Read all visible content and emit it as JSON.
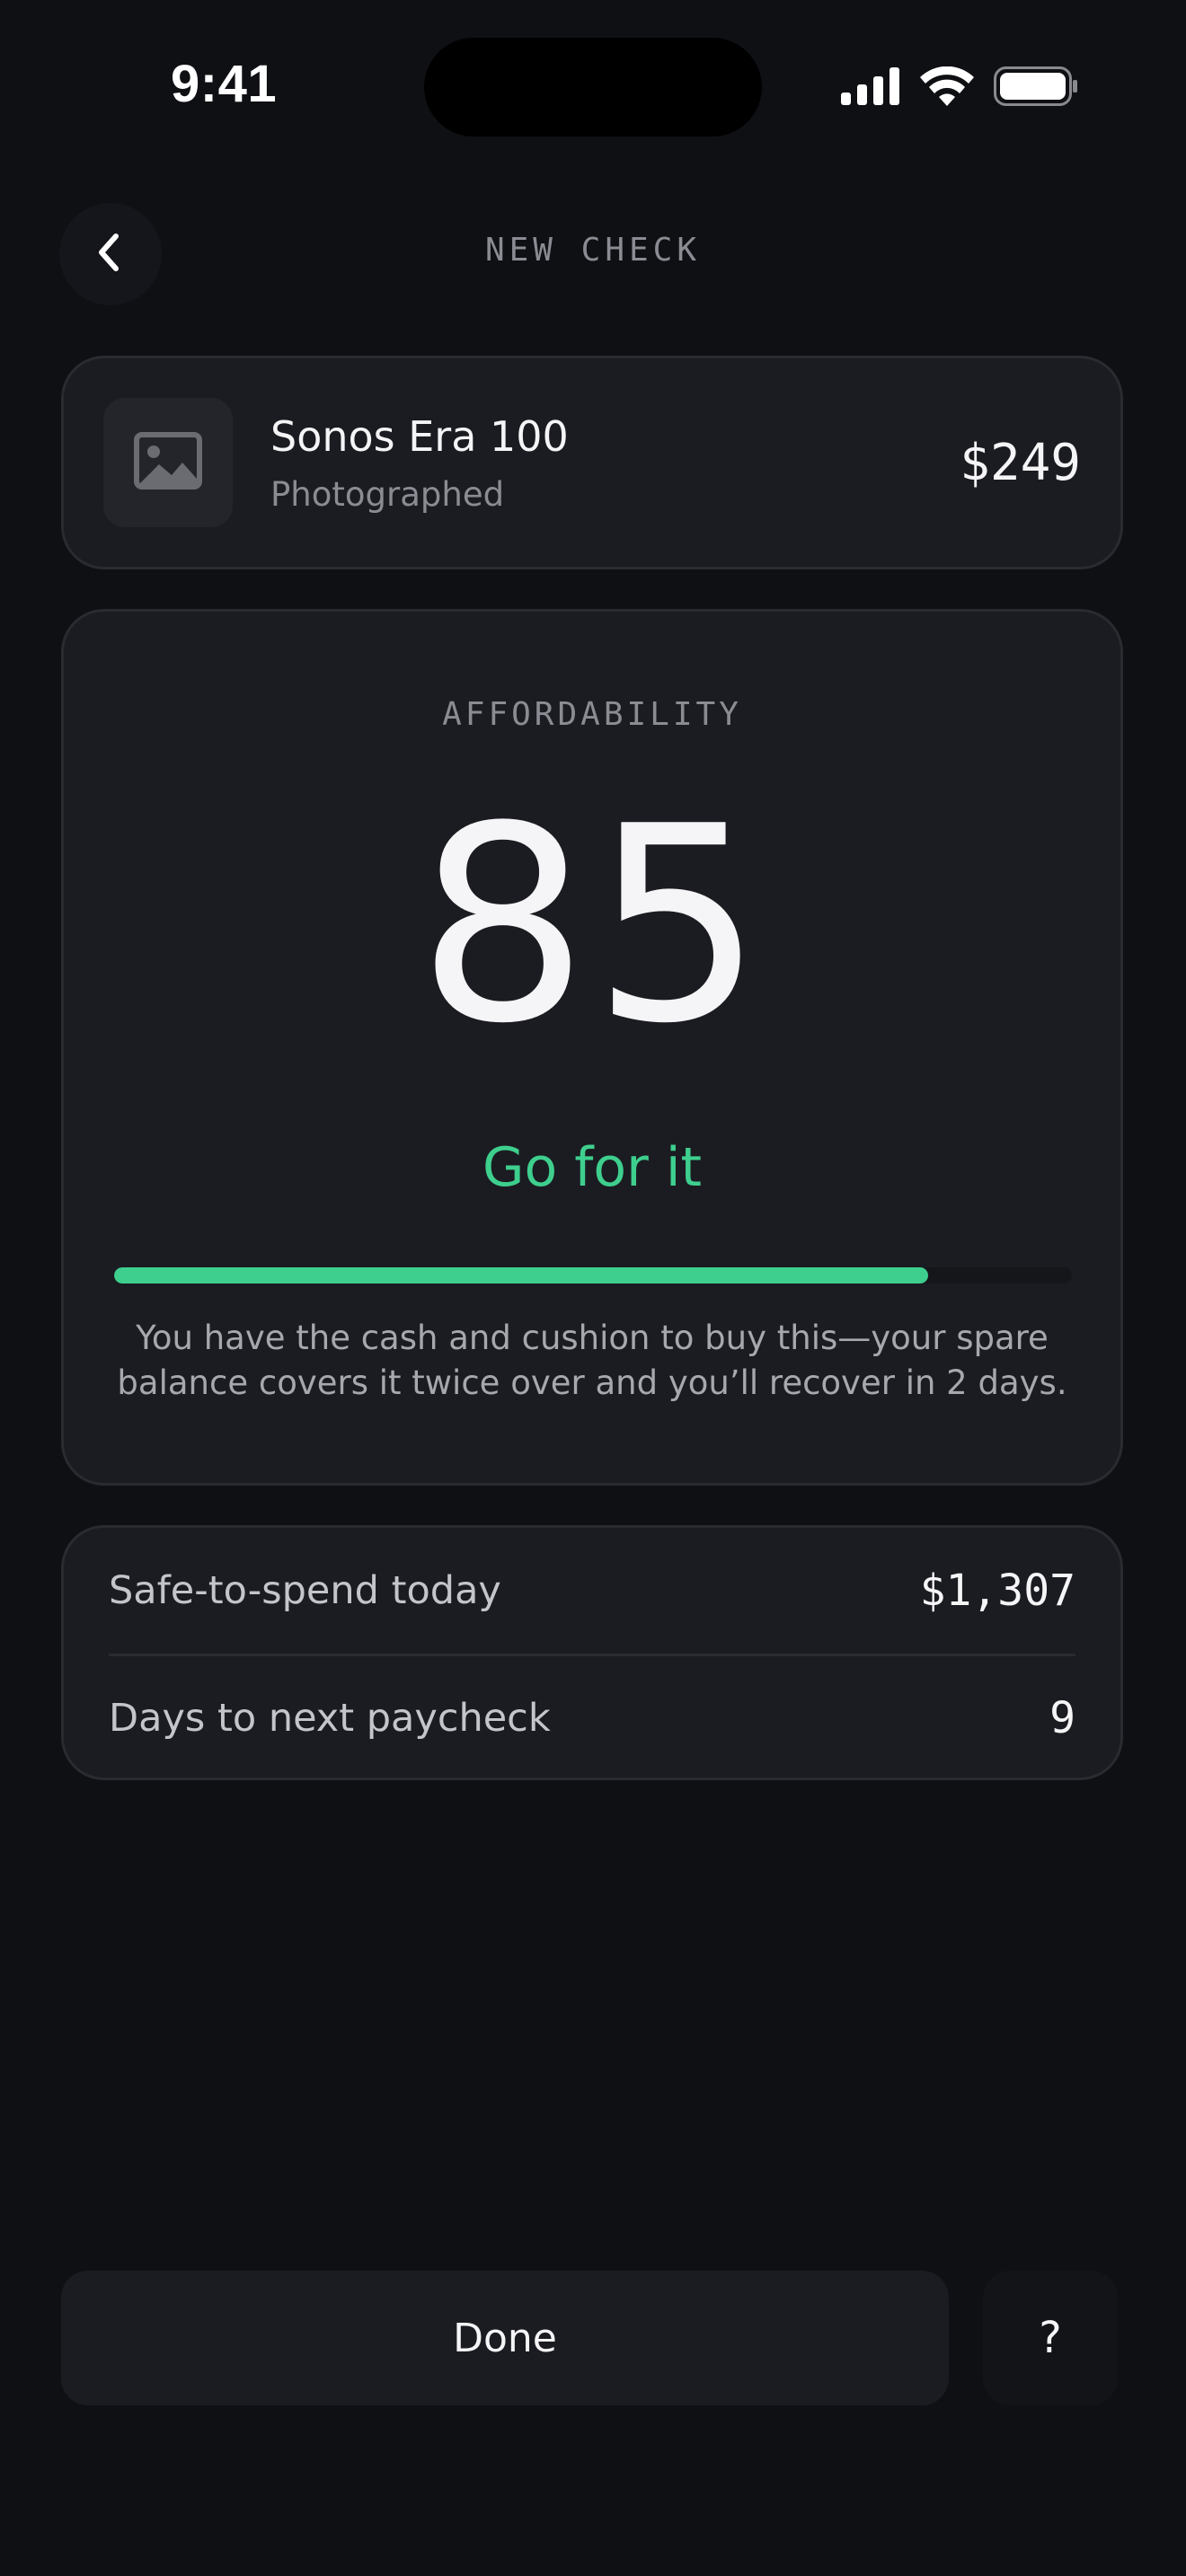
{
  "status_bar": {
    "time": "9:41",
    "signal_icon": "cellular-signal-icon",
    "wifi_icon": "wifi-icon",
    "battery_icon": "battery-icon"
  },
  "header": {
    "back_icon": "chevron-left-icon",
    "title": "NEW CHECK"
  },
  "product": {
    "thumbnail_icon": "image-placeholder-icon",
    "name": "Sonos Era 100",
    "subtitle": "Photographed",
    "price": "$249"
  },
  "affordability": {
    "label": "AFFORDABILITY",
    "score": "85",
    "verdict": "Go for it",
    "progress_percent": 85,
    "description": "You have the cash and cushion to buy this—your spare balance covers it twice over and you’ll recover in 2 days."
  },
  "stats": [
    {
      "label": "Safe-to-spend today",
      "value": "$1,307"
    },
    {
      "label": "Days to next paycheck",
      "value": "9"
    }
  ],
  "footer": {
    "done_label": "Done",
    "help_label": "?"
  },
  "colors": {
    "background": "#0f1014",
    "card": "#1b1c21",
    "accent_green": "#3ecf8e",
    "muted_text": "#8b8c93"
  }
}
